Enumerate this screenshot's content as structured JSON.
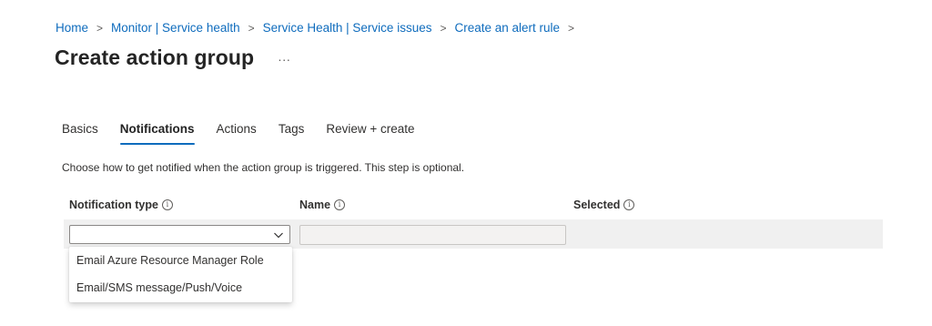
{
  "breadcrumb": {
    "items": [
      "Home",
      "Monitor | Service health",
      "Service Health | Service issues",
      "Create an alert rule"
    ],
    "separator": ">"
  },
  "page": {
    "title": "Create action group",
    "more": "···"
  },
  "tabs": [
    {
      "label": "Basics",
      "active": false
    },
    {
      "label": "Notifications",
      "active": true
    },
    {
      "label": "Actions",
      "active": false
    },
    {
      "label": "Tags",
      "active": false
    },
    {
      "label": "Review + create",
      "active": false
    }
  ],
  "description": "Choose how to get notified when the action group is triggered. This step is optional.",
  "columns": {
    "notification_type": "Notification type",
    "name": "Name",
    "selected": "Selected",
    "info_glyph": "i"
  },
  "row": {
    "notification_type_value": "",
    "name_value": ""
  },
  "dropdown": {
    "options": [
      "Email Azure Resource Manager Role",
      "Email/SMS message/Push/Voice"
    ]
  },
  "colors": {
    "accent": "#0f6cbd",
    "row_background": "#f0f0f0"
  },
  "icons": {
    "info": "info-icon",
    "chevron": "chevron-down-icon"
  }
}
